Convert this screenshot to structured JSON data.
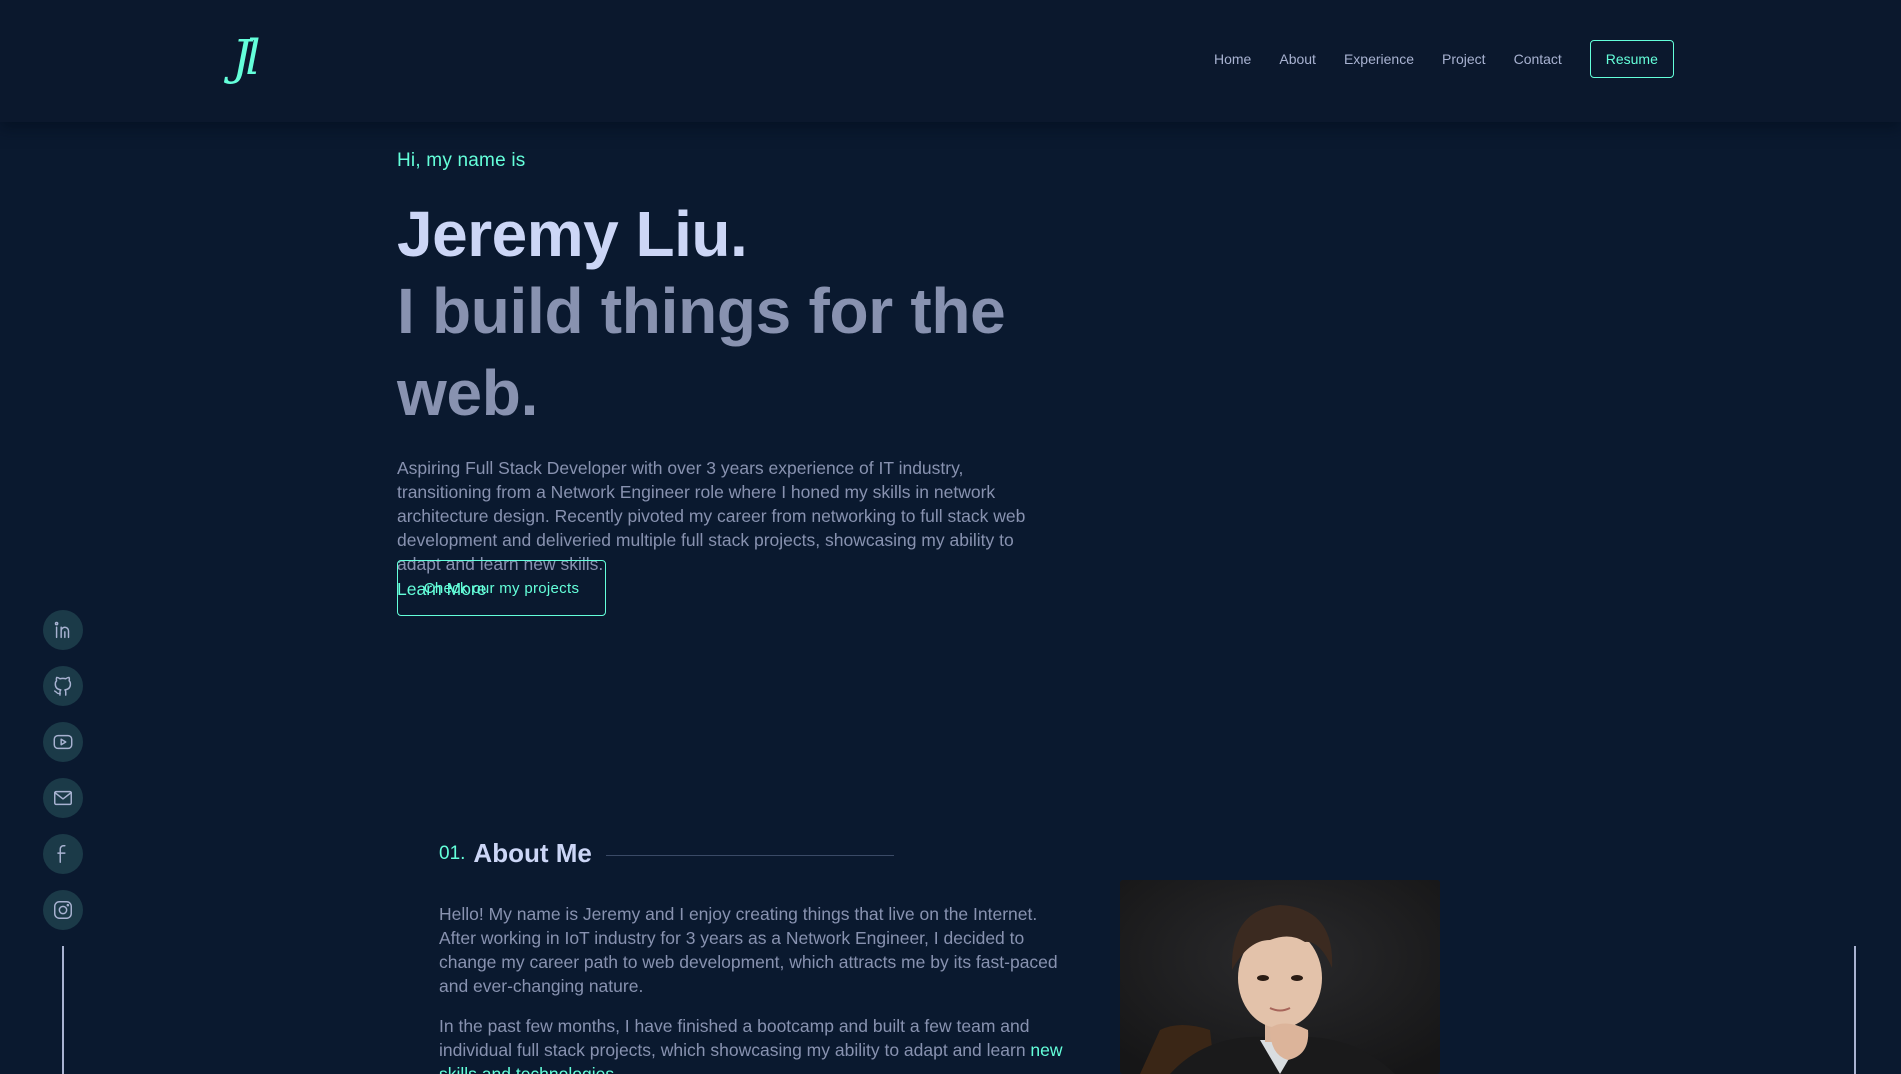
{
  "header": {
    "logo_text": "Jl",
    "nav": [
      "Home",
      "About",
      "Experience",
      "Project",
      "Contact"
    ],
    "resume_label": "Resume"
  },
  "hero": {
    "greeting": "Hi, my name is",
    "name": "Jeremy Liu.",
    "tagline": "I build things for the web.",
    "bio": "Aspiring Full Stack Developer with over 3 years experience of IT industry, transitioning from a Network Engineer role where I honed my skills in network architecture design. Recently pivoted my career from networking to full stack web development and deliveried multiple full stack projects, showcasing my ability to adapt and learn new skills.",
    "learn_more": "Learn More",
    "cta_label": "Check our my projects"
  },
  "social": [
    "linkedin-icon",
    "github-icon",
    "youtube-icon",
    "mail-icon",
    "facebook-icon",
    "instagram-icon"
  ],
  "about": {
    "number": "01.",
    "title": "About Me",
    "para1": "Hello! My name is Jeremy and I enjoy creating things that live on the Internet. After working in IoT industry for 3 years as a Network Engineer, I decided to change my career path to web development, which attracts me by its fast-paced and ever-changing nature.",
    "para2_start": "In the past few months, I have finished a bootcamp and built a few team and individual full stack projects, which showcasing my ability to adapt and learn ",
    "para2_highlight": "new skills and technologies"
  },
  "colors": {
    "background": "#0a192f",
    "accent": "#64ffda",
    "heading": "#ccd6f6",
    "text": "#8892b0"
  }
}
